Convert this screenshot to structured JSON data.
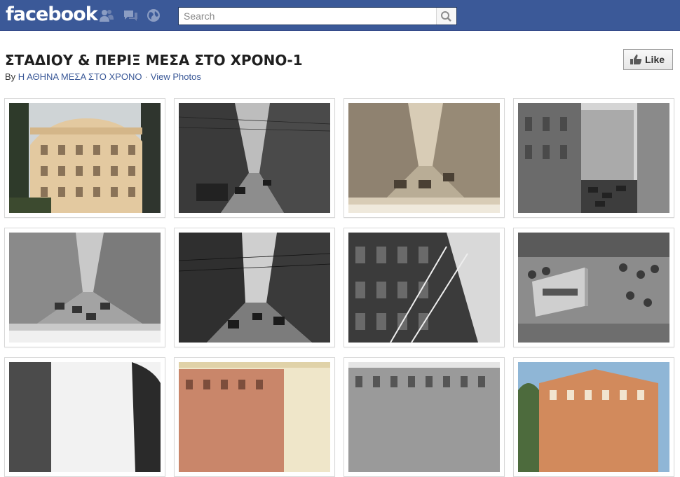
{
  "topbar": {
    "logo": "facebook",
    "search_placeholder": "Search",
    "icons": [
      "friends-icon",
      "messages-icon",
      "notifications-globe-icon",
      "search-icon"
    ]
  },
  "album": {
    "title": "ΣΤΑΔΙΟΥ & ΠΕΡΙΞ ΜΕΣΑ ΣΤΟ ΧΡΟΝΟ-1",
    "by_prefix": "By",
    "author": "Η ΑΘΗΝΑ ΜΕΣΑ ΣΤΟ ΧΡΟΝΟ",
    "separator": "·",
    "view_photos": "View Photos",
    "like_label": "Like"
  },
  "photos": [
    {
      "style": "color-building"
    },
    {
      "style": "bw-street-trams"
    },
    {
      "style": "sepia-postcard-street"
    },
    {
      "style": "bw-buildings-cars"
    },
    {
      "style": "bw-wide-street"
    },
    {
      "style": "bw-street-tramlines"
    },
    {
      "style": "bw-corner-building"
    },
    {
      "style": "bw-crowd-bus"
    },
    {
      "style": "bw-street-trees"
    },
    {
      "style": "color-palace-hotel"
    },
    {
      "style": "bw-grand-building"
    },
    {
      "style": "color-hotel-blue-sky"
    }
  ]
}
